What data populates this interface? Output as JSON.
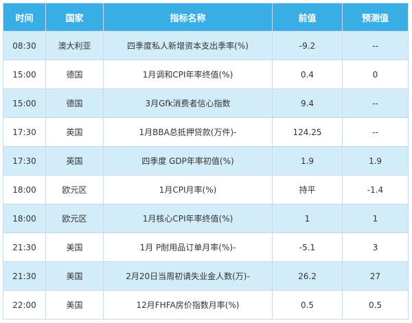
{
  "table": {
    "headers": {
      "time": "时间",
      "country": "国家",
      "indicator": "指标名称",
      "previous": "前值",
      "forecast": "预测值"
    },
    "rows": [
      {
        "time": "08:30",
        "country": "澳大利亚",
        "indicator": "四季度私人新增资本支出季率(%)",
        "previous": "-9.2",
        "forecast": "--"
      },
      {
        "time": "15:00",
        "country": "德国",
        "indicator": "1月调和CPI年率终值(%)",
        "previous": "0.4",
        "forecast": "0"
      },
      {
        "time": "15:00",
        "country": "德国",
        "indicator": "3月Gfk消费者信心指数",
        "previous": "9.4",
        "forecast": "--"
      },
      {
        "time": "17:30",
        "country": "英国",
        "indicator": "1月BBA总抵押贷款(万件)-",
        "previous": "124.25",
        "forecast": "--"
      },
      {
        "time": "17:30",
        "country": "英国",
        "indicator": "四季度 GDP年率初值(%)",
        "previous": "1.9",
        "forecast": "1.9"
      },
      {
        "time": "18:00",
        "country": "欧元区",
        "indicator": "1月CPI月率(%)",
        "previous": "持平",
        "forecast": "-1.4"
      },
      {
        "time": "18:00",
        "country": "欧元区",
        "indicator": "1月核心CPI年率终值(%)",
        "previous": "1",
        "forecast": "1"
      },
      {
        "time": "21:30",
        "country": "美国",
        "indicator": "1月 P耐用品订单月率(%)-",
        "previous": "-5.1",
        "forecast": "3"
      },
      {
        "time": "21:30",
        "country": "美国",
        "indicator": "2月20日当周初请失业金人数(万)-",
        "previous": "26.2",
        "forecast": "27"
      },
      {
        "time": "22:00",
        "country": "美国",
        "indicator": "12月FHFA房价指数月率(%)",
        "previous": "0.5",
        "forecast": "0.5"
      }
    ]
  }
}
